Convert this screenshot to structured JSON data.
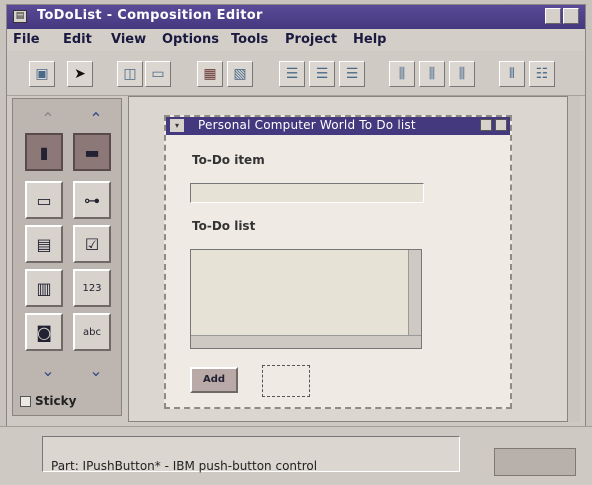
{
  "window": {
    "title": "ToDoList - Composition Editor",
    "app_icon": "app-icon"
  },
  "menu": [
    {
      "label": "File"
    },
    {
      "label": "Edit"
    },
    {
      "label": "View"
    },
    {
      "label": "Options"
    },
    {
      "label": "Tools"
    },
    {
      "label": "Project"
    },
    {
      "label": "Help"
    }
  ],
  "toolbar": {
    "icons": [
      "tool-select-icon",
      "arrow-icon",
      "frame-icon",
      "frame-alt-icon",
      "grid-icon",
      "grid-snap-icon",
      "align-left-icon",
      "align-center-icon",
      "align-right-icon",
      "align-top-icon",
      "align-middle-icon",
      "align-bottom-icon",
      "distribute-h-icon",
      "distribute-v-icon"
    ]
  },
  "palette": {
    "sticky_label": "Sticky"
  },
  "frame": {
    "title": "Personal Computer World To Do list",
    "todo_item_label": "To-Do item",
    "todo_list_label": "To-Do list",
    "add_button": "Add"
  },
  "status": {
    "text": "Part: IPushButton* - IBM push-button control"
  }
}
